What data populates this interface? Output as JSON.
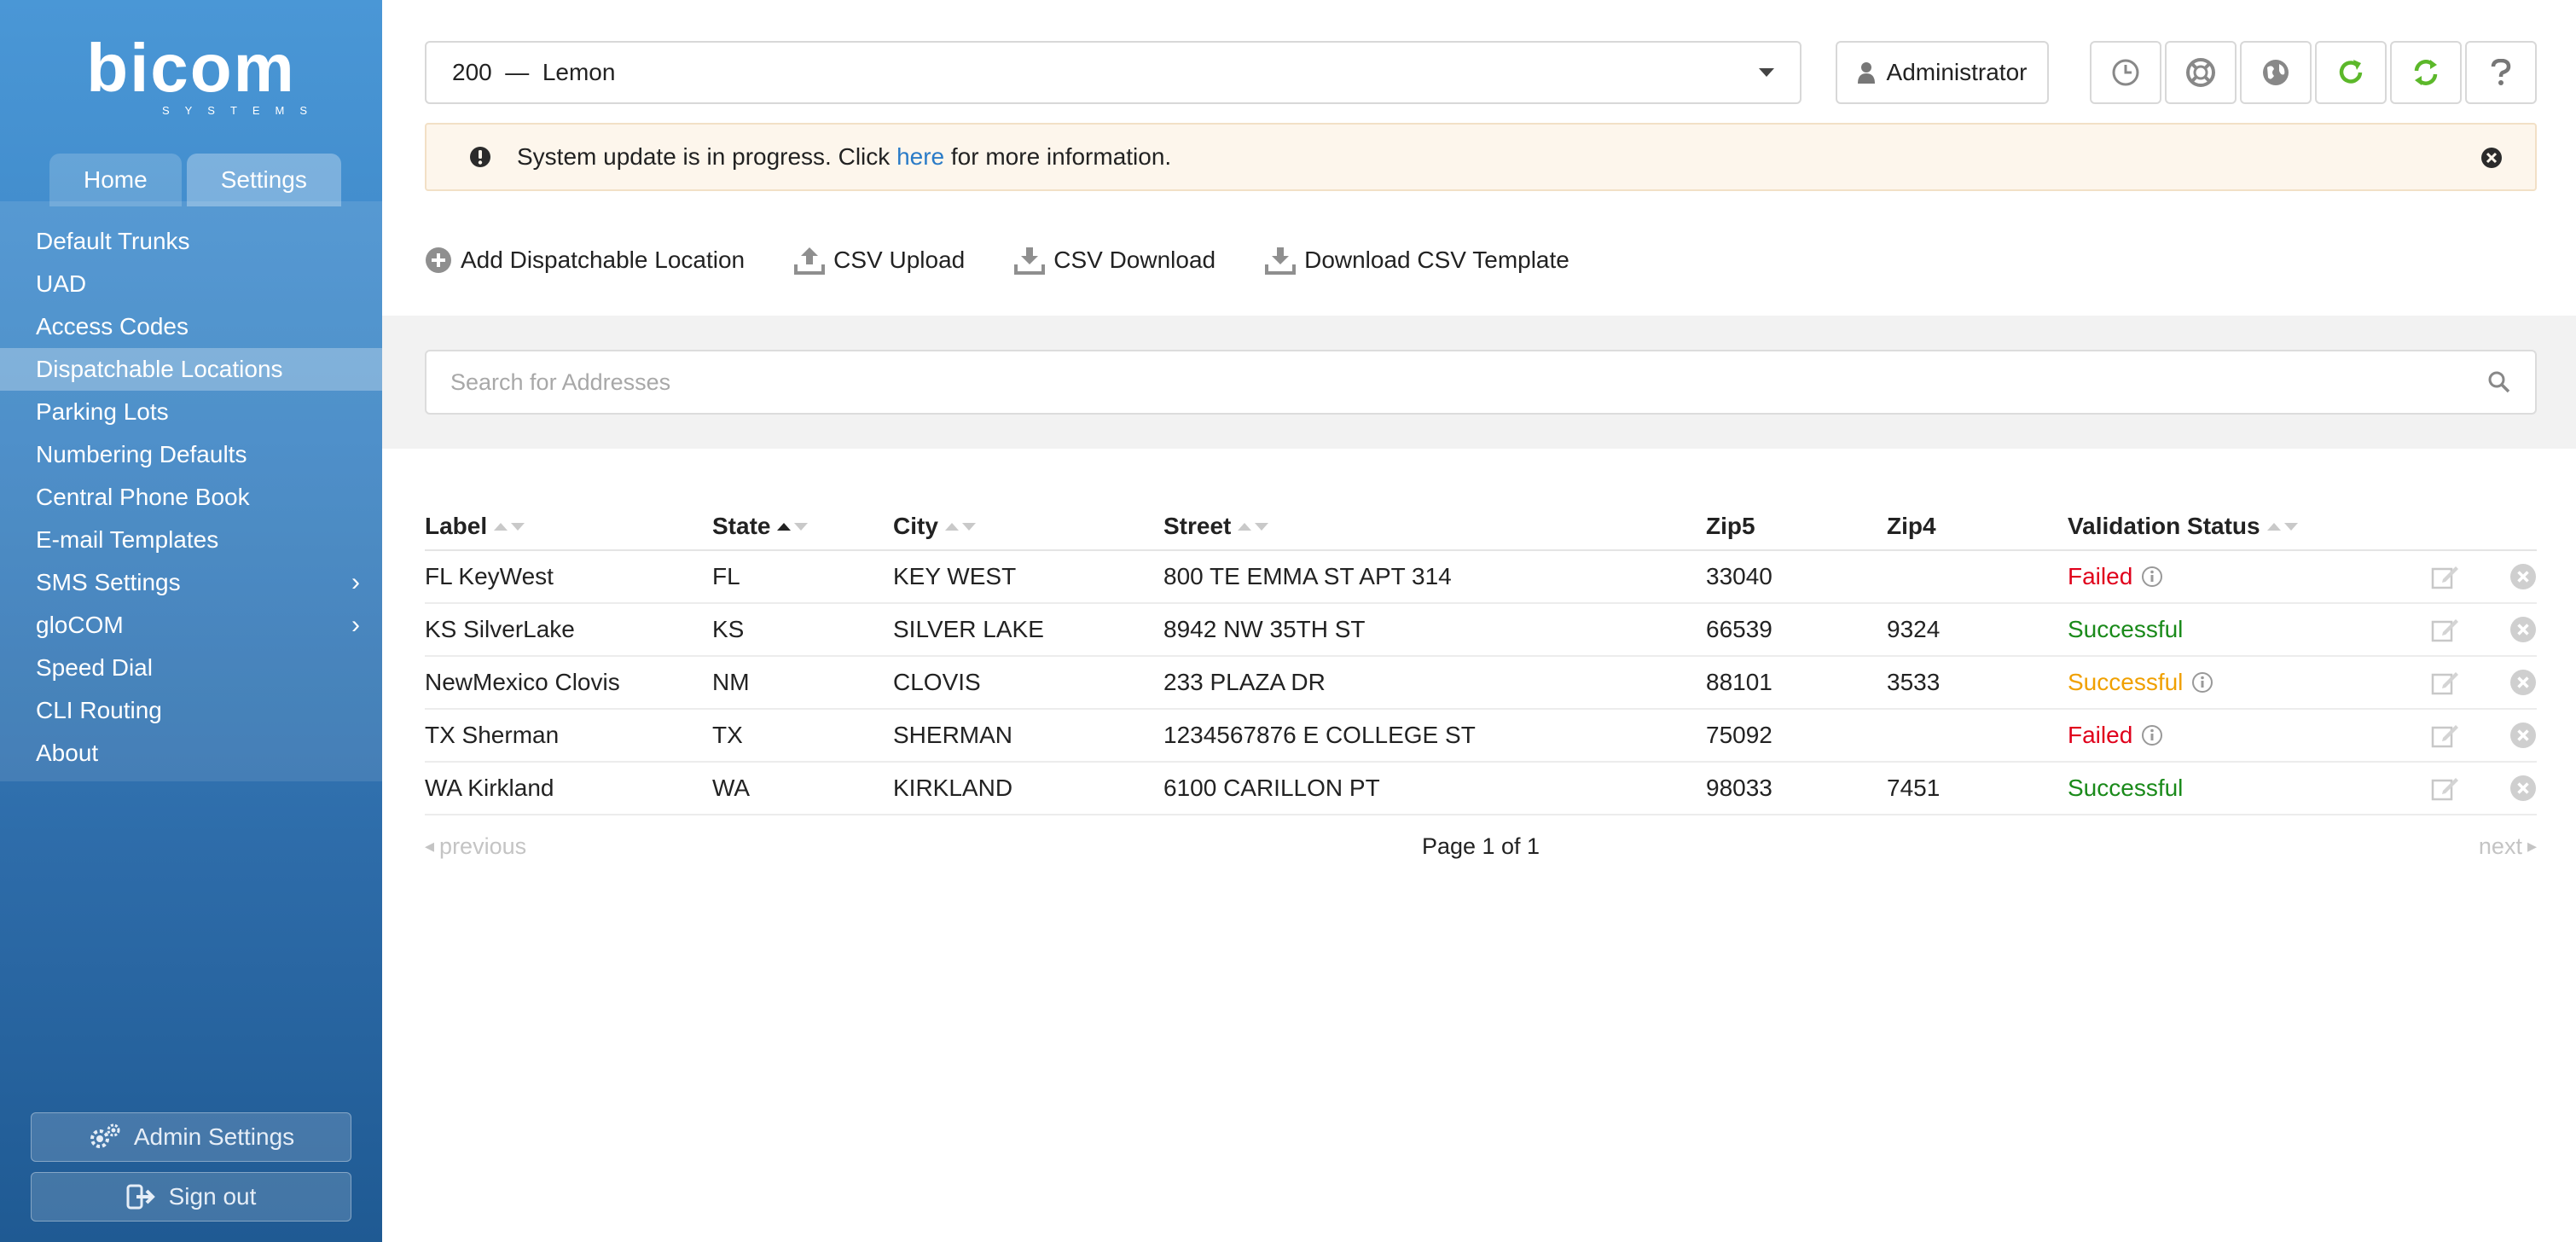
{
  "brand": {
    "logo_text": "bicom",
    "logo_sub": "SYSTEMS"
  },
  "sidebar": {
    "tabs": [
      {
        "label": "Home"
      },
      {
        "label": "Settings",
        "active": true
      }
    ],
    "items": [
      {
        "label": "Default Trunks"
      },
      {
        "label": "UAD"
      },
      {
        "label": "Access Codes"
      },
      {
        "label": "Dispatchable Locations",
        "active": true
      },
      {
        "label": "Parking Lots"
      },
      {
        "label": "Numbering Defaults"
      },
      {
        "label": "Central Phone Book"
      },
      {
        "label": "E-mail Templates"
      },
      {
        "label": "SMS Settings",
        "has_children": true
      },
      {
        "label": "gloCOM",
        "has_children": true
      },
      {
        "label": "Speed Dial"
      },
      {
        "label": "CLI Routing"
      },
      {
        "label": "About"
      }
    ],
    "admin_settings_label": "Admin Settings",
    "sign_out_label": "Sign out"
  },
  "topbar": {
    "tenant_select": "200  —  Lemon",
    "user_label": "Administrator",
    "icons": [
      "clock-icon",
      "lifebuoy-icon",
      "globe-icon",
      "refresh-icon",
      "sync-icon",
      "help-icon"
    ],
    "accent_green": "#5cb82a"
  },
  "alert": {
    "text_before": "System update is in progress. Click ",
    "link": "here",
    "text_after": " for more information."
  },
  "actions": [
    {
      "label": "Add Dispatchable Location",
      "icon": "plus-circle-icon"
    },
    {
      "label": "CSV Upload",
      "icon": "upload-icon"
    },
    {
      "label": "CSV Download",
      "icon": "download-icon"
    },
    {
      "label": "Download CSV Template",
      "icon": "download-template-icon"
    }
  ],
  "search": {
    "placeholder": "Search for Addresses"
  },
  "table": {
    "headers": {
      "label": "Label",
      "state": "State",
      "city": "City",
      "street": "Street",
      "zip5": "Zip5",
      "zip4": "Zip4",
      "validation": "Validation Status"
    },
    "rows": [
      {
        "label": "FL KeyWest",
        "state": "FL",
        "city": "KEY WEST",
        "street": "800 TE EMMA ST APT 314",
        "zip5": "33040",
        "zip4": "",
        "status": "Failed",
        "status_type": "failed",
        "info": true
      },
      {
        "label": "KS SilverLake",
        "state": "KS",
        "city": "SILVER LAKE",
        "street": "8942 NW 35TH ST",
        "zip5": "66539",
        "zip4": "9324",
        "status": "Successful",
        "status_type": "ok",
        "info": false
      },
      {
        "label": "NewMexico Clovis",
        "state": "NM",
        "city": "CLOVIS",
        "street": "233 PLAZA DR",
        "zip5": "88101",
        "zip4": "3533",
        "status": "Successful",
        "status_type": "warn",
        "info": true
      },
      {
        "label": "TX Sherman",
        "state": "TX",
        "city": "SHERMAN",
        "street": "1234567876 E COLLEGE ST",
        "zip5": "75092",
        "zip4": "",
        "status": "Failed",
        "status_type": "failed",
        "info": true
      },
      {
        "label": "WA Kirkland",
        "state": "WA",
        "city": "KIRKLAND",
        "street": "6100 CARILLON PT",
        "zip5": "98033",
        "zip4": "7451",
        "status": "Successful",
        "status_type": "ok",
        "info": false
      }
    ]
  },
  "pager": {
    "previous": "previous",
    "page": "Page 1 of 1",
    "next": "next"
  }
}
